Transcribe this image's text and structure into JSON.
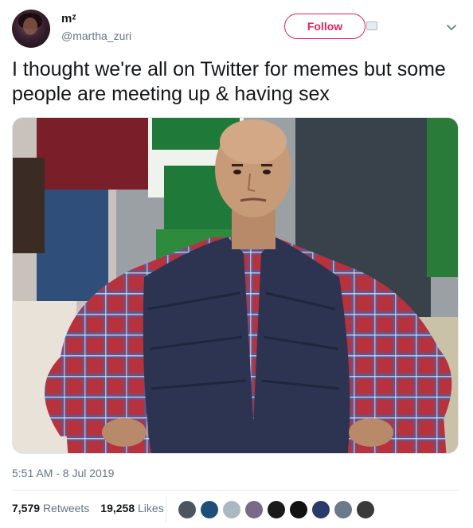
{
  "author": {
    "display_name": "mᶻ",
    "username": "@martha_zuri",
    "avatar_icon": "profile-photo"
  },
  "header": {
    "follow_label": "Follow",
    "chevron_icon": "chevron-down-icon"
  },
  "tweet": {
    "text": "I thought we're all on Twitter for memes but some people are meeting up & having sex",
    "media_description": "meme-photo"
  },
  "meta": {
    "timestamp": "5:51 AM - 8 Jul 2019"
  },
  "stats": {
    "retweets_count": "7,579",
    "retweets_label": "Retweets",
    "likes_count": "19,258",
    "likes_label": "Likes"
  },
  "likers": [
    {
      "name": "liker-avatar-1",
      "color": "#4a5560"
    },
    {
      "name": "liker-avatar-2",
      "color": "#1d4f7a"
    },
    {
      "name": "liker-avatar-3",
      "color": "#aab8c2"
    },
    {
      "name": "liker-avatar-4",
      "color": "#7a6a8a"
    },
    {
      "name": "liker-avatar-5",
      "color": "#1a1a1a"
    },
    {
      "name": "liker-avatar-6",
      "color": "#111111"
    },
    {
      "name": "liker-avatar-7",
      "color": "#2a3a6a"
    },
    {
      "name": "liker-avatar-8",
      "color": "#6a7a8a"
    },
    {
      "name": "liker-avatar-9",
      "color": "#3a3a3a"
    }
  ],
  "colors": {
    "accent": "#e0245e",
    "text_primary": "#14171a",
    "text_secondary": "#657786",
    "divider": "#e6ecf0"
  }
}
